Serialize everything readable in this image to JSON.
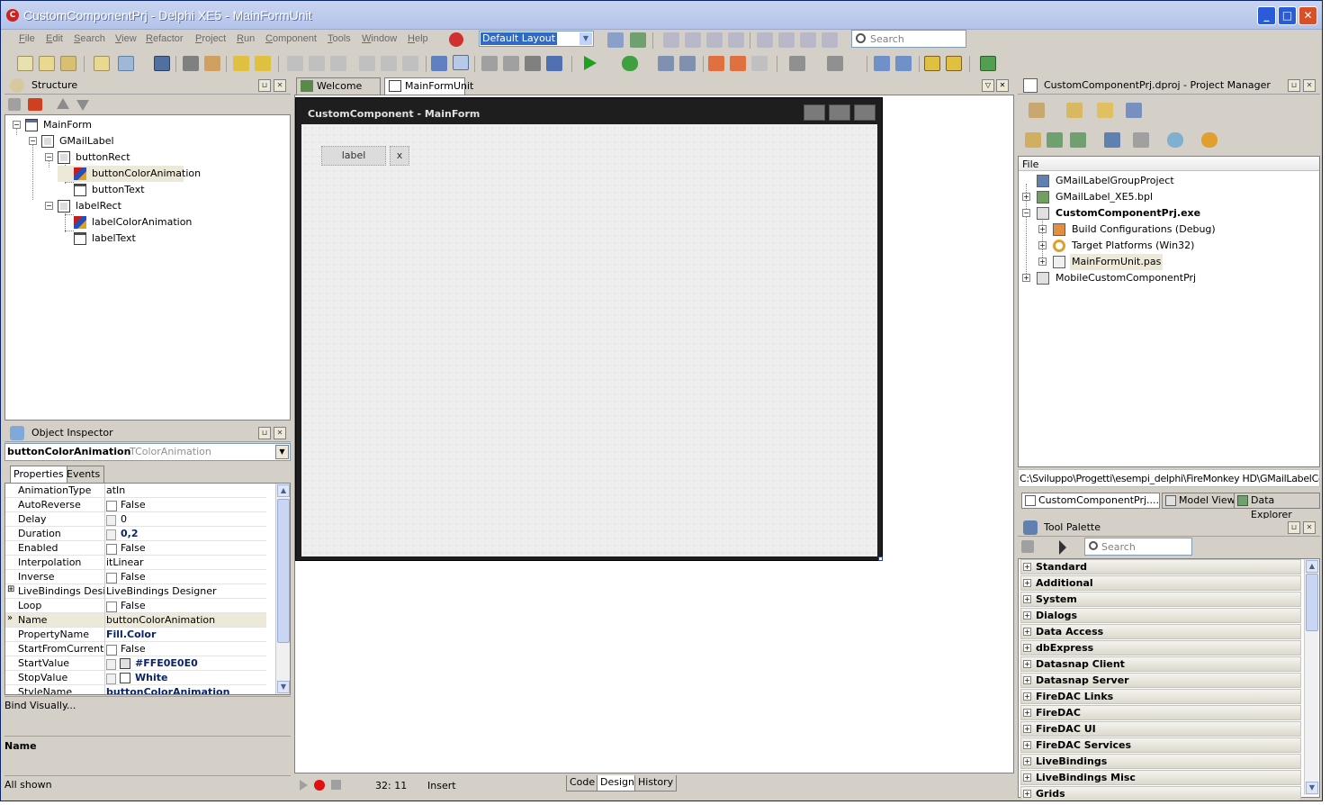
{
  "window": {
    "title": "CustomComponentPrj - Delphi XE5 - MainFormUnit",
    "app_icon": "delphi-icon"
  },
  "menu": [
    "File",
    "Edit",
    "Search",
    "View",
    "Refactor",
    "Project",
    "Run",
    "Component",
    "Tools",
    "Window",
    "Help"
  ],
  "toolbar": {
    "layout_value": "Default Layout",
    "search_placeholder": "Search"
  },
  "structure": {
    "title": "Structure",
    "tree": [
      {
        "label": "MainForm",
        "icon": "form-icon",
        "level": 0,
        "exp": "-"
      },
      {
        "label": "GMailLabel",
        "icon": "rect-icon",
        "level": 1,
        "exp": "-"
      },
      {
        "label": "buttonRect",
        "icon": "rect-icon",
        "level": 2,
        "exp": "-"
      },
      {
        "label": "buttonColorAnimation",
        "icon": "animation-icon",
        "level": 3,
        "exp": "",
        "selected": true
      },
      {
        "label": "buttonText",
        "icon": "text-icon",
        "level": 3,
        "exp": ""
      },
      {
        "label": "labelRect",
        "icon": "rect-icon",
        "level": 2,
        "exp": "-"
      },
      {
        "label": "labelColorAnimation",
        "icon": "animation-icon",
        "level": 3,
        "exp": ""
      },
      {
        "label": "labelText",
        "icon": "text-icon",
        "level": 3,
        "exp": ""
      }
    ]
  },
  "inspector": {
    "title": "Object Inspector",
    "selected_name": "buttonColorAnimation",
    "selected_type": "TColorAnimation",
    "tabs": [
      "Properties",
      "Events"
    ],
    "rows": [
      {
        "name": "AnimationType",
        "value": "atIn",
        "kind": "text"
      },
      {
        "name": "AutoReverse",
        "value": "False",
        "kind": "check"
      },
      {
        "name": "Delay",
        "value": "0",
        "kind": "stepper"
      },
      {
        "name": "Duration",
        "value": "0,2",
        "kind": "stepper-bold"
      },
      {
        "name": "Enabled",
        "value": "False",
        "kind": "check"
      },
      {
        "name": "Interpolation",
        "value": "itLinear",
        "kind": "text"
      },
      {
        "name": "Inverse",
        "value": "False",
        "kind": "check"
      },
      {
        "name": "LiveBindings Designer",
        "value": "LiveBindings Designer",
        "kind": "text",
        "expandable": true
      },
      {
        "name": "Loop",
        "value": "False",
        "kind": "check"
      },
      {
        "name": "Name",
        "value": "buttonColorAnimation",
        "kind": "text",
        "current": true
      },
      {
        "name": "PropertyName",
        "value": "Fill.Color",
        "kind": "bold"
      },
      {
        "name": "StartFromCurrent",
        "value": "False",
        "kind": "check"
      },
      {
        "name": "StartValue",
        "value": "#FFE0E0E0",
        "kind": "color",
        "color": "#e0e0e0"
      },
      {
        "name": "StopValue",
        "value": "White",
        "kind": "color",
        "color": "#ffffff"
      },
      {
        "name": "StyleName",
        "value": "buttonColorAnimation",
        "kind": "bold"
      }
    ],
    "bind_visually": "Bind Visually...",
    "desc_title": "Name",
    "status": "All shown"
  },
  "editor": {
    "tabs": [
      "Welcome Page",
      "MainFormUnit"
    ],
    "form_title": "CustomComponent - MainForm",
    "label_button": "label",
    "x_button": "x",
    "status_pos": "32:  11",
    "status_mode": "Insert",
    "bottom_tabs": [
      "Code",
      "Design",
      "History"
    ]
  },
  "project": {
    "title": "CustomComponentPrj.dproj - Project Manager",
    "col_header": "File",
    "tree": [
      {
        "label": "GMailLabelGroupProject",
        "icon": "group-icon",
        "level": 0,
        "exp": ""
      },
      {
        "label": "GMailLabel_XE5.bpl",
        "icon": "package-icon",
        "level": 0,
        "exp": "+"
      },
      {
        "label": "CustomComponentPrj.exe",
        "icon": "exe-icon",
        "level": 0,
        "exp": "-",
        "bold": true
      },
      {
        "label": "Build Configurations (Debug)",
        "icon": "build-icon",
        "level": 1,
        "exp": "+"
      },
      {
        "label": "Target Platforms (Win32)",
        "icon": "target-icon",
        "level": 1,
        "exp": "+"
      },
      {
        "label": "MainFormUnit.pas",
        "icon": "unit-icon",
        "level": 1,
        "exp": "+",
        "selected": true
      },
      {
        "label": "MobileCustomComponentPrj",
        "icon": "project-icon",
        "level": 0,
        "exp": "+"
      }
    ],
    "path": "C:\\Sviluppo\\Progetti\\esempi_delphi\\FireMonkey HD\\GMailLabelCompor",
    "bottom_tabs": [
      "CustomComponentPrj....",
      "Model View",
      "Data Explorer"
    ]
  },
  "palette": {
    "title": "Tool Palette",
    "search_placeholder": "Search",
    "categories": [
      "Standard",
      "Additional",
      "System",
      "Dialogs",
      "Data Access",
      "dbExpress",
      "Datasnap Client",
      "Datasnap Server",
      "FireDAC Links",
      "FireDAC",
      "FireDAC UI",
      "FireDAC Services",
      "LiveBindings",
      "LiveBindings Misc",
      "Grids"
    ]
  }
}
